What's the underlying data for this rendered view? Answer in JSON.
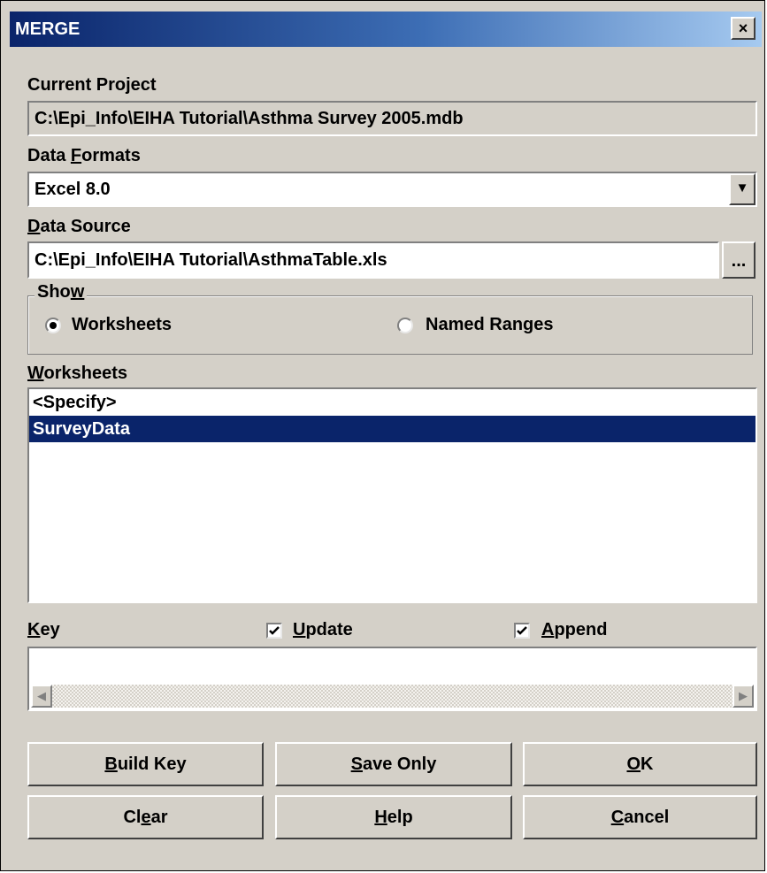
{
  "window": {
    "title": "MERGE",
    "close_label": "×"
  },
  "current_project": {
    "label": "Current Project",
    "value": "C:\\Epi_Info\\EIHA Tutorial\\Asthma Survey 2005.mdb"
  },
  "data_formats": {
    "label_pre": "Data ",
    "label_key": "F",
    "label_post": "ormats",
    "value": "Excel 8.0"
  },
  "data_source": {
    "label_key": "D",
    "label_post": "ata Source",
    "value": "C:\\Epi_Info\\EIHA Tutorial\\AsthmaTable.xls",
    "browse_label": "..."
  },
  "show": {
    "legend_pre": "Sho",
    "legend_key": "w",
    "options": [
      {
        "label": "Worksheets",
        "selected": true
      },
      {
        "label": "Named Ranges",
        "selected": false
      }
    ]
  },
  "worksheets": {
    "label_key": "W",
    "label_post": "orksheets",
    "items": [
      "<Specify>",
      "SurveyData"
    ],
    "selected_index": 1
  },
  "key": {
    "label_key": "K",
    "label_post": "ey",
    "update": {
      "key": "U",
      "rest": "pdate",
      "checked": true
    },
    "append": {
      "key": "A",
      "rest": "ppend",
      "checked": true
    }
  },
  "buttons": {
    "build_key": {
      "key": "B",
      "rest": "uild Key"
    },
    "save_only": {
      "key": "S",
      "rest": "ave Only"
    },
    "ok": {
      "key": "O",
      "rest": "K"
    },
    "clear": {
      "pre": "Cl",
      "key": "e",
      "rest": "ar"
    },
    "help": {
      "key": "H",
      "rest": "elp"
    },
    "cancel": {
      "key": "C",
      "rest": "ancel"
    }
  },
  "icons": {
    "dropdown": "triangle-down",
    "radio": "radio-button",
    "checkbox": "checkmark",
    "scroll_left": "triangle-left",
    "scroll_right": "triangle-right"
  },
  "colors": {
    "titlebar_start": "#0a246a",
    "titlebar_end": "#a6caf0",
    "selection": "#0a246a",
    "face": "#d4d0c8"
  }
}
